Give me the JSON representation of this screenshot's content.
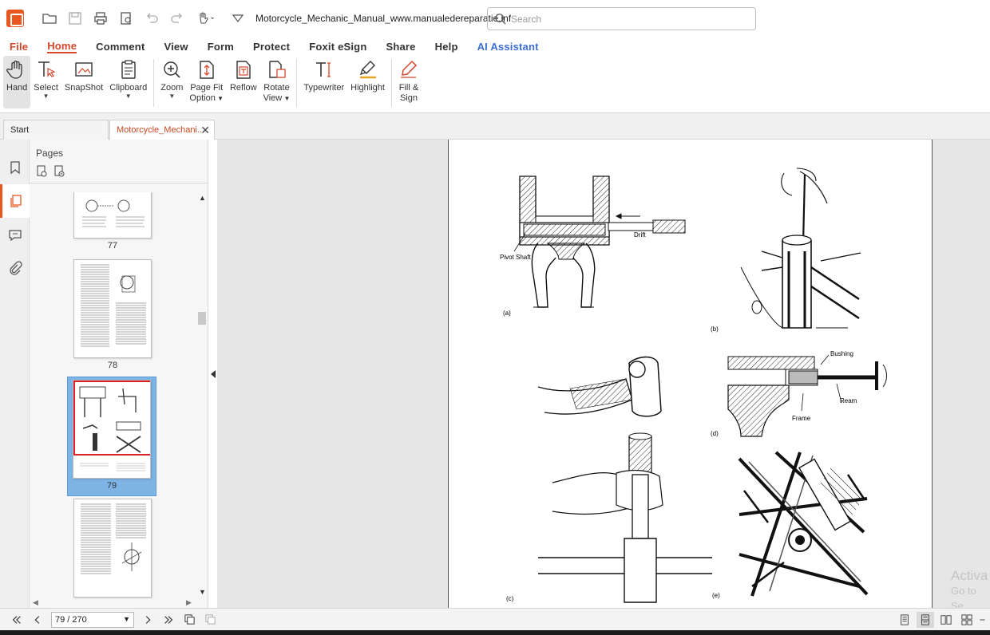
{
  "titlebar": {
    "doc_title": "Motorcycle_Mechanic_Manual_www.manualedereparatie.info.p...",
    "search_placeholder": "Search"
  },
  "ribbon": {
    "menus": [
      "File",
      "Home",
      "Comment",
      "View",
      "Form",
      "Protect",
      "Foxit eSign",
      "Share",
      "Help",
      "AI Assistant"
    ],
    "active_menu": "Home",
    "tools": {
      "hand": "Hand",
      "select": "Select",
      "snapshot": "SnapShot",
      "clipboard": "Clipboard",
      "zoom": "Zoom",
      "pagefit_1": "Page Fit",
      "pagefit_2": "Option",
      "reflow": "Reflow",
      "rotate_1": "Rotate",
      "rotate_2": "View",
      "typewriter": "Typewriter",
      "highlight": "Highlight",
      "fill_1": "Fill &",
      "fill_2": "Sign"
    }
  },
  "tabs": {
    "start": "Start",
    "doc": "Motorcycle_Mechani...",
    "close": "✕"
  },
  "pages_panel": {
    "title": "Pages",
    "thumbnails": [
      {
        "label": "77"
      },
      {
        "label": "78"
      },
      {
        "label": "79"
      },
      {
        "label": ""
      }
    ]
  },
  "document": {
    "labels": {
      "drift": "Drift",
      "pivot_shaft": "Pivot Shaft",
      "a": "(a)",
      "b": "(b)",
      "bushing": "Bushing",
      "ream": "Ream",
      "frame": "Frame",
      "d": "(d)",
      "c": "(c)",
      "e": "(e)"
    }
  },
  "watermark": {
    "line1": "Activa",
    "line2": "Go to Se"
  },
  "statusbar": {
    "page_value": "79 / 270"
  },
  "colors": {
    "accent": "#d4472b",
    "ai": "#3b6fd8",
    "selection": "#7eb3e6"
  }
}
